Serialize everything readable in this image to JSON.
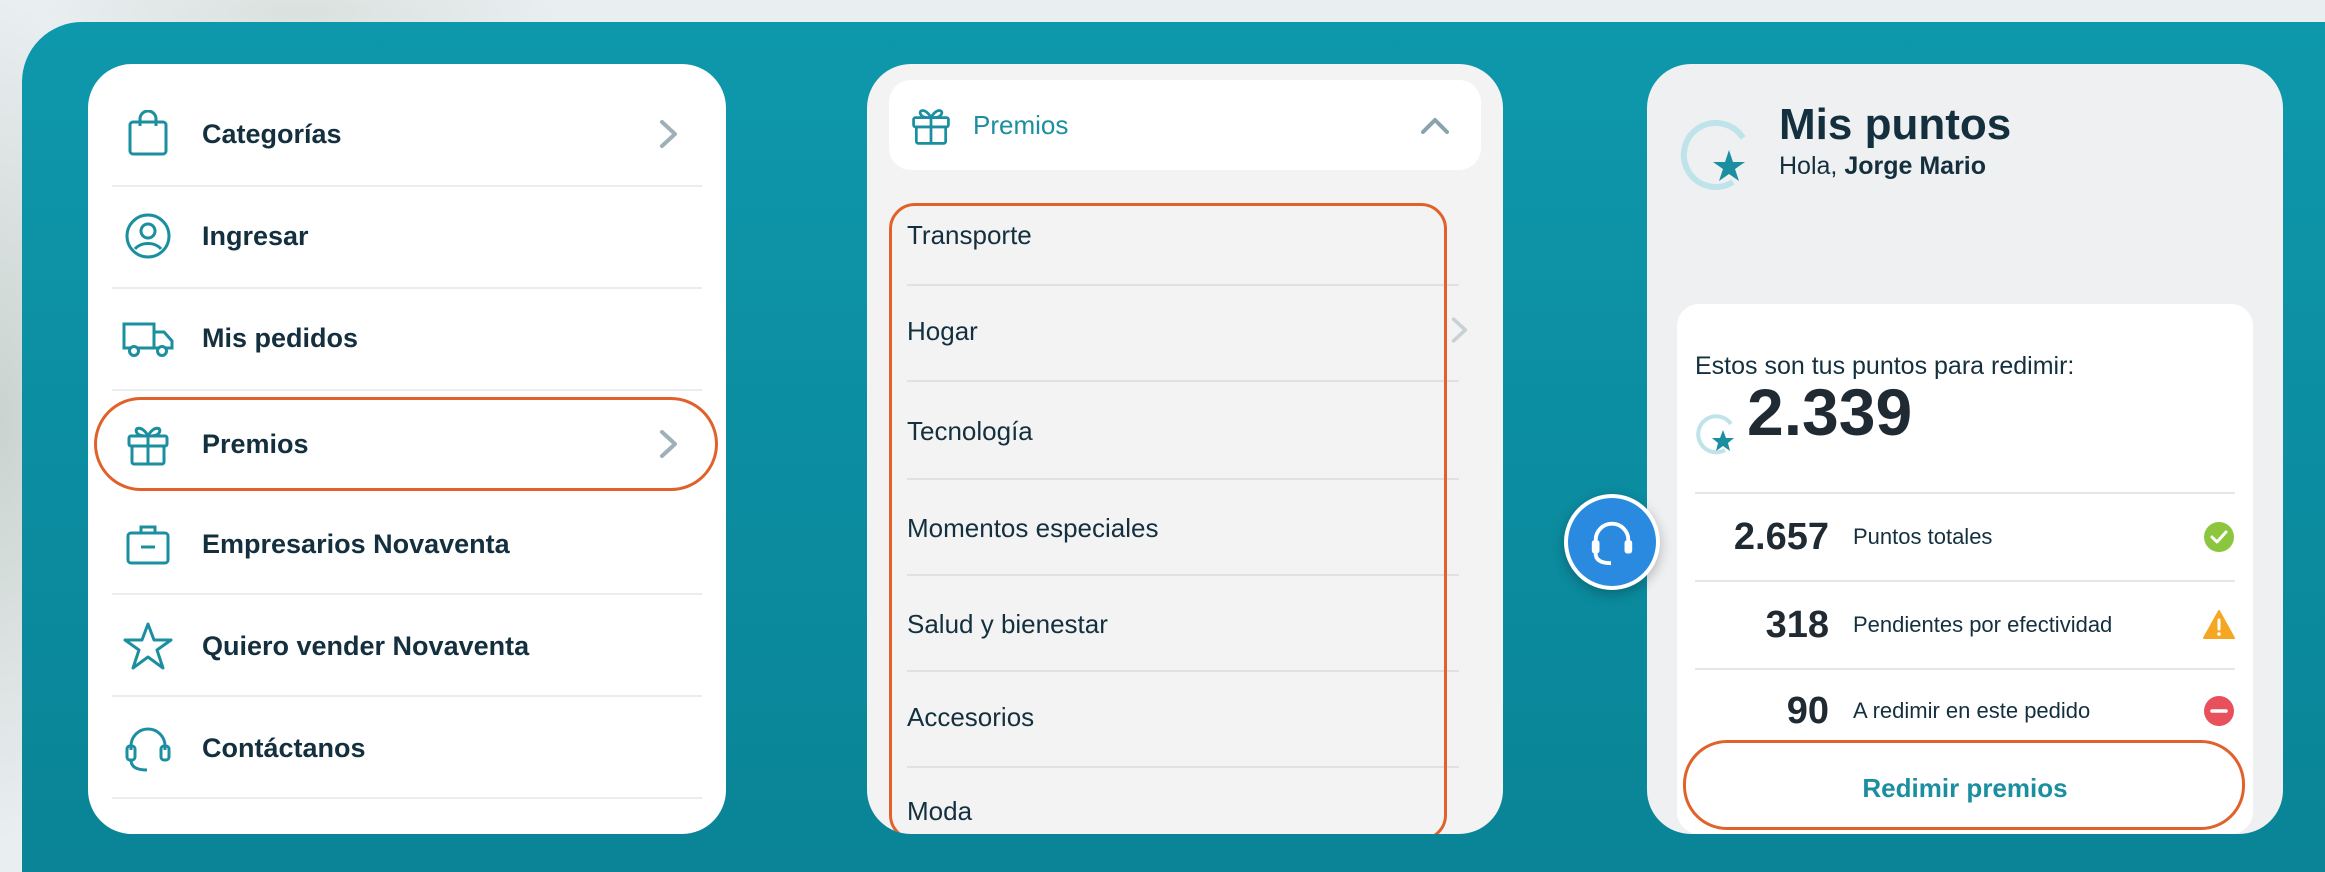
{
  "menu": {
    "items": [
      {
        "label": "Categorías",
        "icon": "shopping-bag-icon",
        "has_chevron": true
      },
      {
        "label": "Ingresar",
        "icon": "user-circle-icon",
        "has_chevron": false
      },
      {
        "label": "Mis pedidos",
        "icon": "delivery-truck-icon",
        "has_chevron": false
      },
      {
        "label": "Premios",
        "icon": "gift-icon",
        "has_chevron": true,
        "highlighted": true
      },
      {
        "label": "Empresarios Novaventa",
        "icon": "briefcase-icon",
        "has_chevron": false
      },
      {
        "label": "Quiero vender Novaventa",
        "icon": "star-icon",
        "has_chevron": false
      },
      {
        "label": "Contáctanos",
        "icon": "headset-icon",
        "has_chevron": false
      }
    ]
  },
  "premios": {
    "header_label": "Premios",
    "header_icon": "gift-icon",
    "expanded": true,
    "items": [
      "Transporte",
      "Hogar",
      "Tecnología",
      "Momentos especiales",
      "Salud y bienestar",
      "Accesorios",
      "Moda"
    ]
  },
  "puntos": {
    "title": "Mis puntos",
    "greeting_prefix": "Hola,",
    "user_name": "Jorge Mario",
    "lead": "Estos son tus puntos para redimir:",
    "available": "2.339",
    "rows": [
      {
        "value": "2.657",
        "label": "Puntos totales",
        "status": "ok",
        "status_color": "#8cc63f"
      },
      {
        "value": "318",
        "label": "Pendientes por efectividad",
        "status": "warning",
        "status_color": "#f5a623"
      },
      {
        "value": "90",
        "label": "A redimir en este pedido",
        "status": "error",
        "status_color": "#e8505b"
      }
    ],
    "redeem_button": "Redimir premios"
  },
  "colors": {
    "teal_background": "#0e98ac",
    "accent_teal": "#1b8fa0",
    "highlight_orange": "#e0622a",
    "text_dark": "#14303f"
  }
}
